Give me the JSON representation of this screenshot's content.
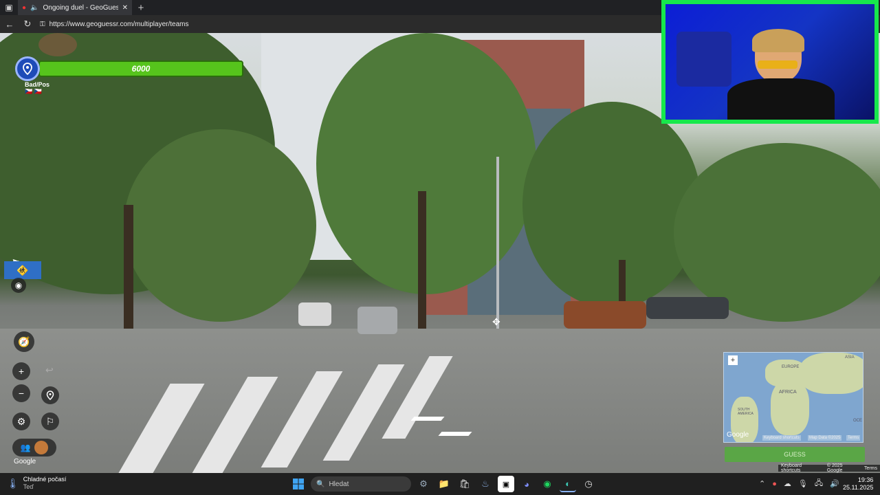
{
  "browser": {
    "tab_title": "Ongoing duel - GeoGuessr",
    "url": "https://www.geoguessr.com/multiplayer/teams",
    "close_glyph": "✕",
    "new_tab_glyph": "+"
  },
  "hud": {
    "health": "6000",
    "team_names": "Bad/Pos 🇨🇿 🇨🇿"
  },
  "viewport": {
    "google_logo": "Google"
  },
  "minimap": {
    "labels": [
      "EUROPE",
      "ASIA",
      "AFRICA",
      "SOUTH AMERICA",
      "OCE"
    ],
    "google": "Google",
    "keyboard": "Keyboard shortcuts",
    "mapdata": "Map Data ©2025",
    "terms": "Terms",
    "guess": "GUESS"
  },
  "footer": {
    "keyboard": "Keyboard shortcuts",
    "copyright": "© 2025 Google",
    "terms": "Terms"
  },
  "taskbar": {
    "weather_title": "Chladné počasí",
    "weather_sub": "Teď",
    "search_placeholder": "Hledat",
    "time": "19:36",
    "date": "25.11.2025"
  },
  "colors": {
    "health": "#56c41c",
    "webcam_border": "#17e84c",
    "taskbar": "#202020"
  }
}
